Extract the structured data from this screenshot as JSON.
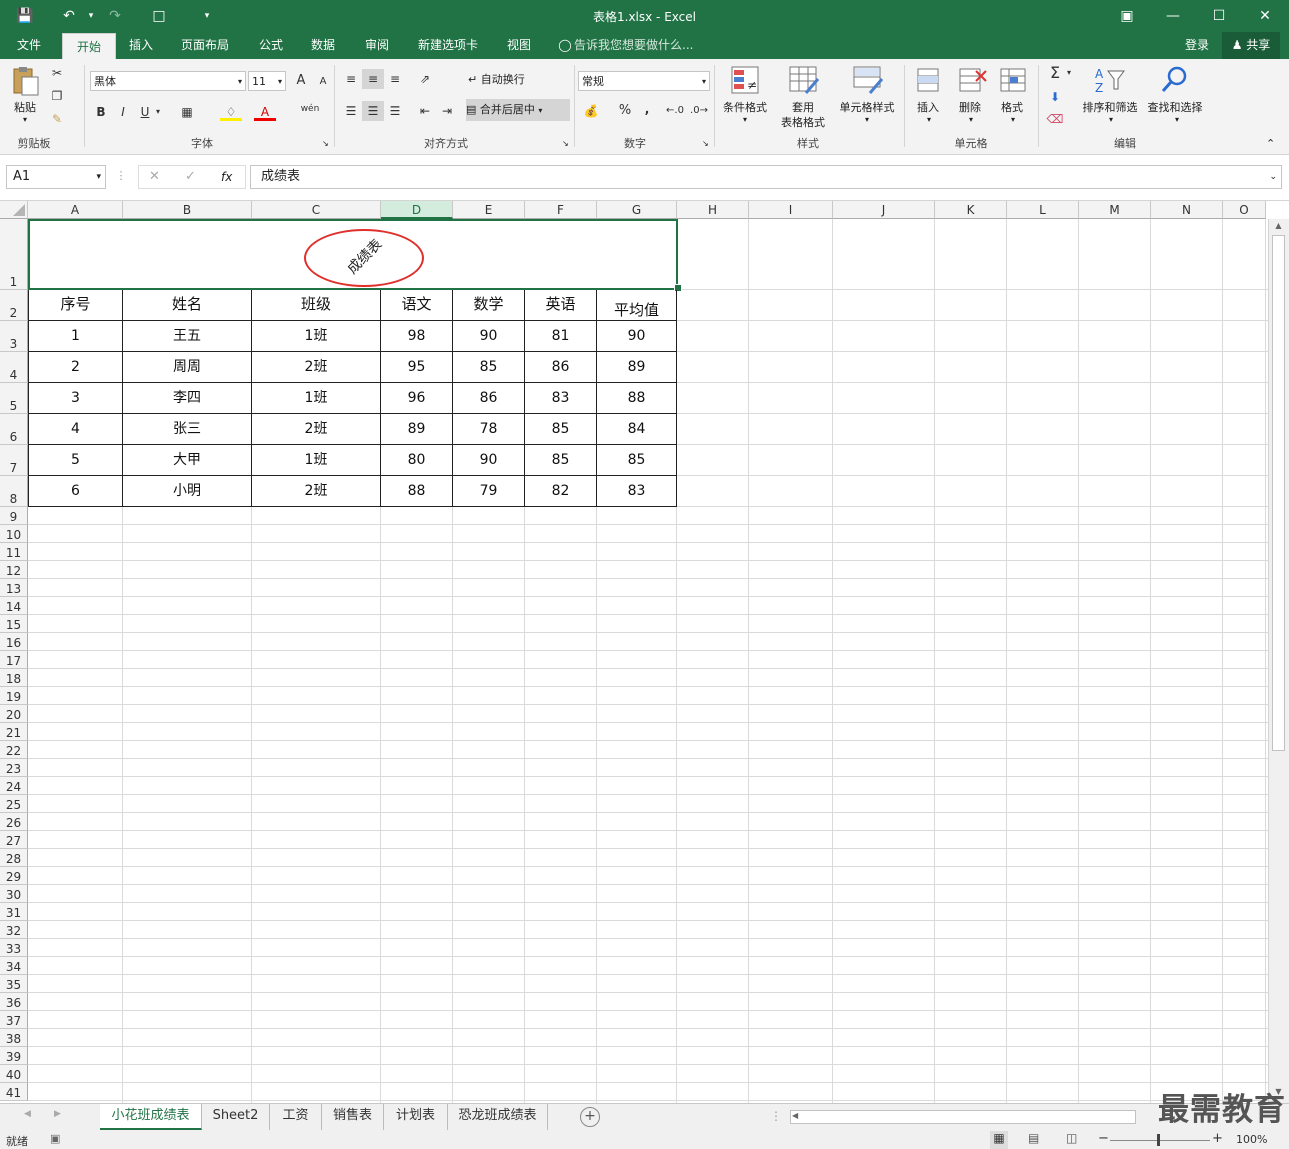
{
  "window": {
    "title": "表格1.xlsx - Excel",
    "login": "登录",
    "share": "共享"
  },
  "tabs": [
    "文件",
    "开始",
    "插入",
    "页面布局",
    "公式",
    "数据",
    "审阅",
    "新建选项卡",
    "视图"
  ],
  "tell_me": "告诉我您想要做什么...",
  "ribbon": {
    "clipboard": {
      "paste": "粘贴",
      "label": "剪贴板"
    },
    "font": {
      "name": "黑体",
      "size": "11",
      "bold": "B",
      "italic": "I",
      "underline": "U",
      "label": "字体",
      "grow": "A",
      "shrink": "A",
      "font_color": "A",
      "phonetic": "wén"
    },
    "alignment": {
      "wrap": "自动换行",
      "merge": "合并后居中",
      "label": "对齐方式"
    },
    "number": {
      "format": "常规",
      "percent": "%",
      "comma": ",",
      "label": "数字"
    },
    "styles": {
      "conditional": "条件格式",
      "table_line1": "套用",
      "table_line2": "表格格式",
      "cell_styles": "单元格样式",
      "label": "样式"
    },
    "cells": {
      "insert": "插入",
      "delete": "删除",
      "format": "格式",
      "label": "单元格"
    },
    "editing": {
      "sort": "排序和筛选",
      "find": "查找和选择",
      "label": "编辑",
      "sum": "Σ"
    }
  },
  "formula_bar": {
    "name_box": "A1",
    "fx": "fx",
    "content": "成绩表"
  },
  "columns": [
    "A",
    "B",
    "C",
    "D",
    "E",
    "F",
    "G",
    "H",
    "I",
    "J",
    "K",
    "L",
    "M",
    "N",
    "O"
  ],
  "selected_column": "D",
  "rows": [
    "1",
    "2",
    "3",
    "4",
    "5",
    "6",
    "7",
    "8",
    "9",
    "10",
    "11",
    "12",
    "13",
    "14",
    "15",
    "16",
    "17",
    "18",
    "19",
    "20",
    "21",
    "22",
    "23",
    "24",
    "25",
    "26",
    "27",
    "28",
    "29",
    "30",
    "31",
    "32",
    "33",
    "34",
    "35",
    "36",
    "37",
    "38",
    "39",
    "40",
    "41"
  ],
  "sheet": {
    "title": "成绩表",
    "headers": [
      "序号",
      "姓名",
      "班级",
      "语文",
      "数学",
      "英语",
      "平均值"
    ],
    "data": [
      [
        "1",
        "王五",
        "1班",
        "98",
        "90",
        "81",
        "90"
      ],
      [
        "2",
        "周周",
        "2班",
        "95",
        "85",
        "86",
        "89"
      ],
      [
        "3",
        "李四",
        "1班",
        "96",
        "86",
        "83",
        "88"
      ],
      [
        "4",
        "张三",
        "2班",
        "89",
        "78",
        "85",
        "84"
      ],
      [
        "5",
        "大甲",
        "1班",
        "80",
        "90",
        "85",
        "85"
      ],
      [
        "6",
        "小明",
        "2班",
        "88",
        "79",
        "82",
        "83"
      ]
    ]
  },
  "sheet_tabs": [
    "小花班成绩表",
    "Sheet2",
    "工资",
    "销售表",
    "计划表",
    "恐龙班成绩表"
  ],
  "active_sheet": "小花班成绩表",
  "status": {
    "ready": "就绪",
    "zoom": "100%"
  },
  "watermark": "最需教育",
  "colors": {
    "brand": "#217346",
    "circle": "#e0302c"
  }
}
